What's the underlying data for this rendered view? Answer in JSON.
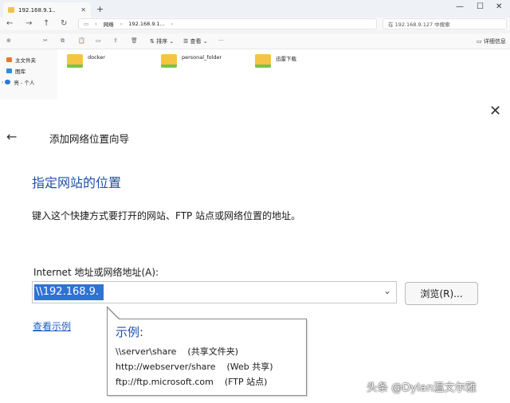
{
  "explorer": {
    "tab_label": "192.168.9.1..",
    "address": {
      "crumbs": [
        "网络",
        "192.168.9.1..."
      ]
    },
    "search_placeholder": "在 192.168.9.127 中搜索",
    "toolbar": {
      "sort_label": "排序",
      "view_label": "查看",
      "details_label": "详细信息"
    },
    "nav_items": [
      "主文件夹",
      "图库",
      "亮 - 个人"
    ],
    "folders": [
      "docker",
      "personal_folder",
      "迅雷下载"
    ]
  },
  "wizard": {
    "title": "添加网络位置向导",
    "heading": "指定网站的位置",
    "description": "键入这个快捷方式要打开的网站、FTP 站点或网络位置的地址。",
    "address_label": "Internet 地址或网络地址(A):",
    "address_value": "\\\\192.168.9.",
    "browse_label": "浏览(R)...",
    "examples_link": "查看示例",
    "tooltip": {
      "title": "示例:",
      "lines": [
        "\\\\server\\share    (共享文件夹)",
        "http://webserver/share    (Web 共享)",
        "ftp://ftp.microsoft.com    (FTP 站点)"
      ]
    }
  },
  "watermark": "头条 @Dylan温文尔雅",
  "colors": {
    "accent_blue": "#1f4fa8",
    "selection": "#3071d4",
    "link": "#1f5cc4"
  }
}
